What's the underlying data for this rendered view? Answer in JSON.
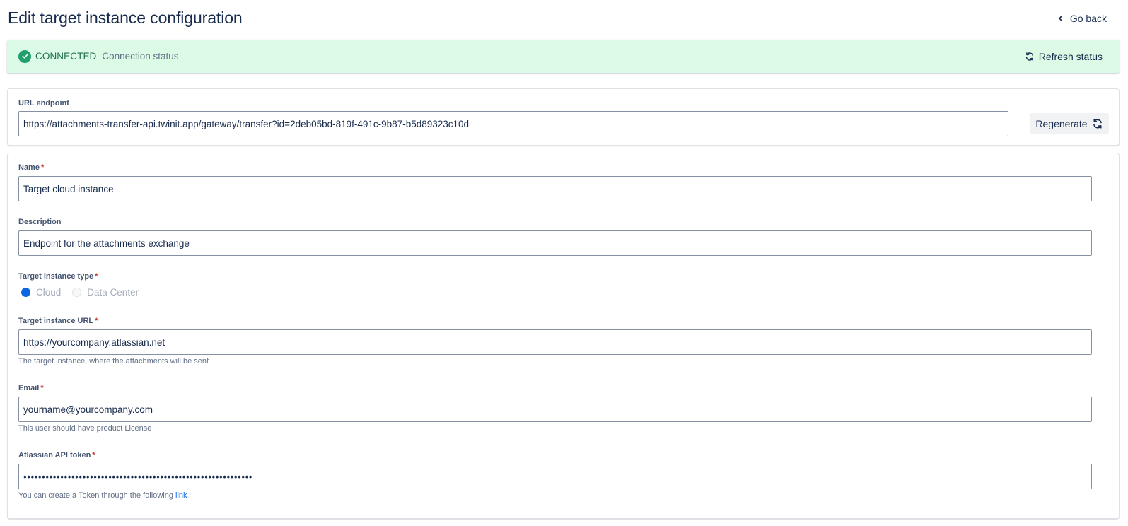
{
  "header": {
    "title": "Edit target instance configuration",
    "go_back": "Go back"
  },
  "status": {
    "label": "CONNECTED",
    "description": "Connection status",
    "refresh": "Refresh status",
    "color": "#22a06b"
  },
  "url_endpoint": {
    "label": "URL endpoint",
    "value": "https://attachments-transfer-api.twinit.app/gateway/transfer?id=2deb05bd-819f-491c-9b87-b5d89323c10d",
    "regenerate": "Regenerate"
  },
  "form": {
    "name": {
      "label": "Name",
      "required": "*",
      "value": "Target cloud instance"
    },
    "description": {
      "label": "Description",
      "value": "Endpoint for the attachments exchange"
    },
    "instance_type": {
      "label": "Target instance type",
      "required": "*",
      "options": [
        "Cloud",
        "Data Center"
      ],
      "selected": "Cloud"
    },
    "instance_url": {
      "label": "Target instance URL",
      "required": "*",
      "value": "https://yourcompany.atlassian.net",
      "helper": "The target instance, where the attachments will be sent"
    },
    "email": {
      "label": "Email",
      "required": "*",
      "value": "yourname@yourcompany.com",
      "helper": "This user should have product License"
    },
    "api_token": {
      "label": "Atlassian API token",
      "required": "*",
      "value": "••••••••••••••••••••••••••••••••••••••••••••••••••••••••••••••",
      "helper": "You can create a Token through the following",
      "helper_link": "link"
    }
  },
  "colors": {
    "accent": "#0c66e4",
    "success_bg": "#dcfbe6",
    "required": "#c9372c"
  }
}
